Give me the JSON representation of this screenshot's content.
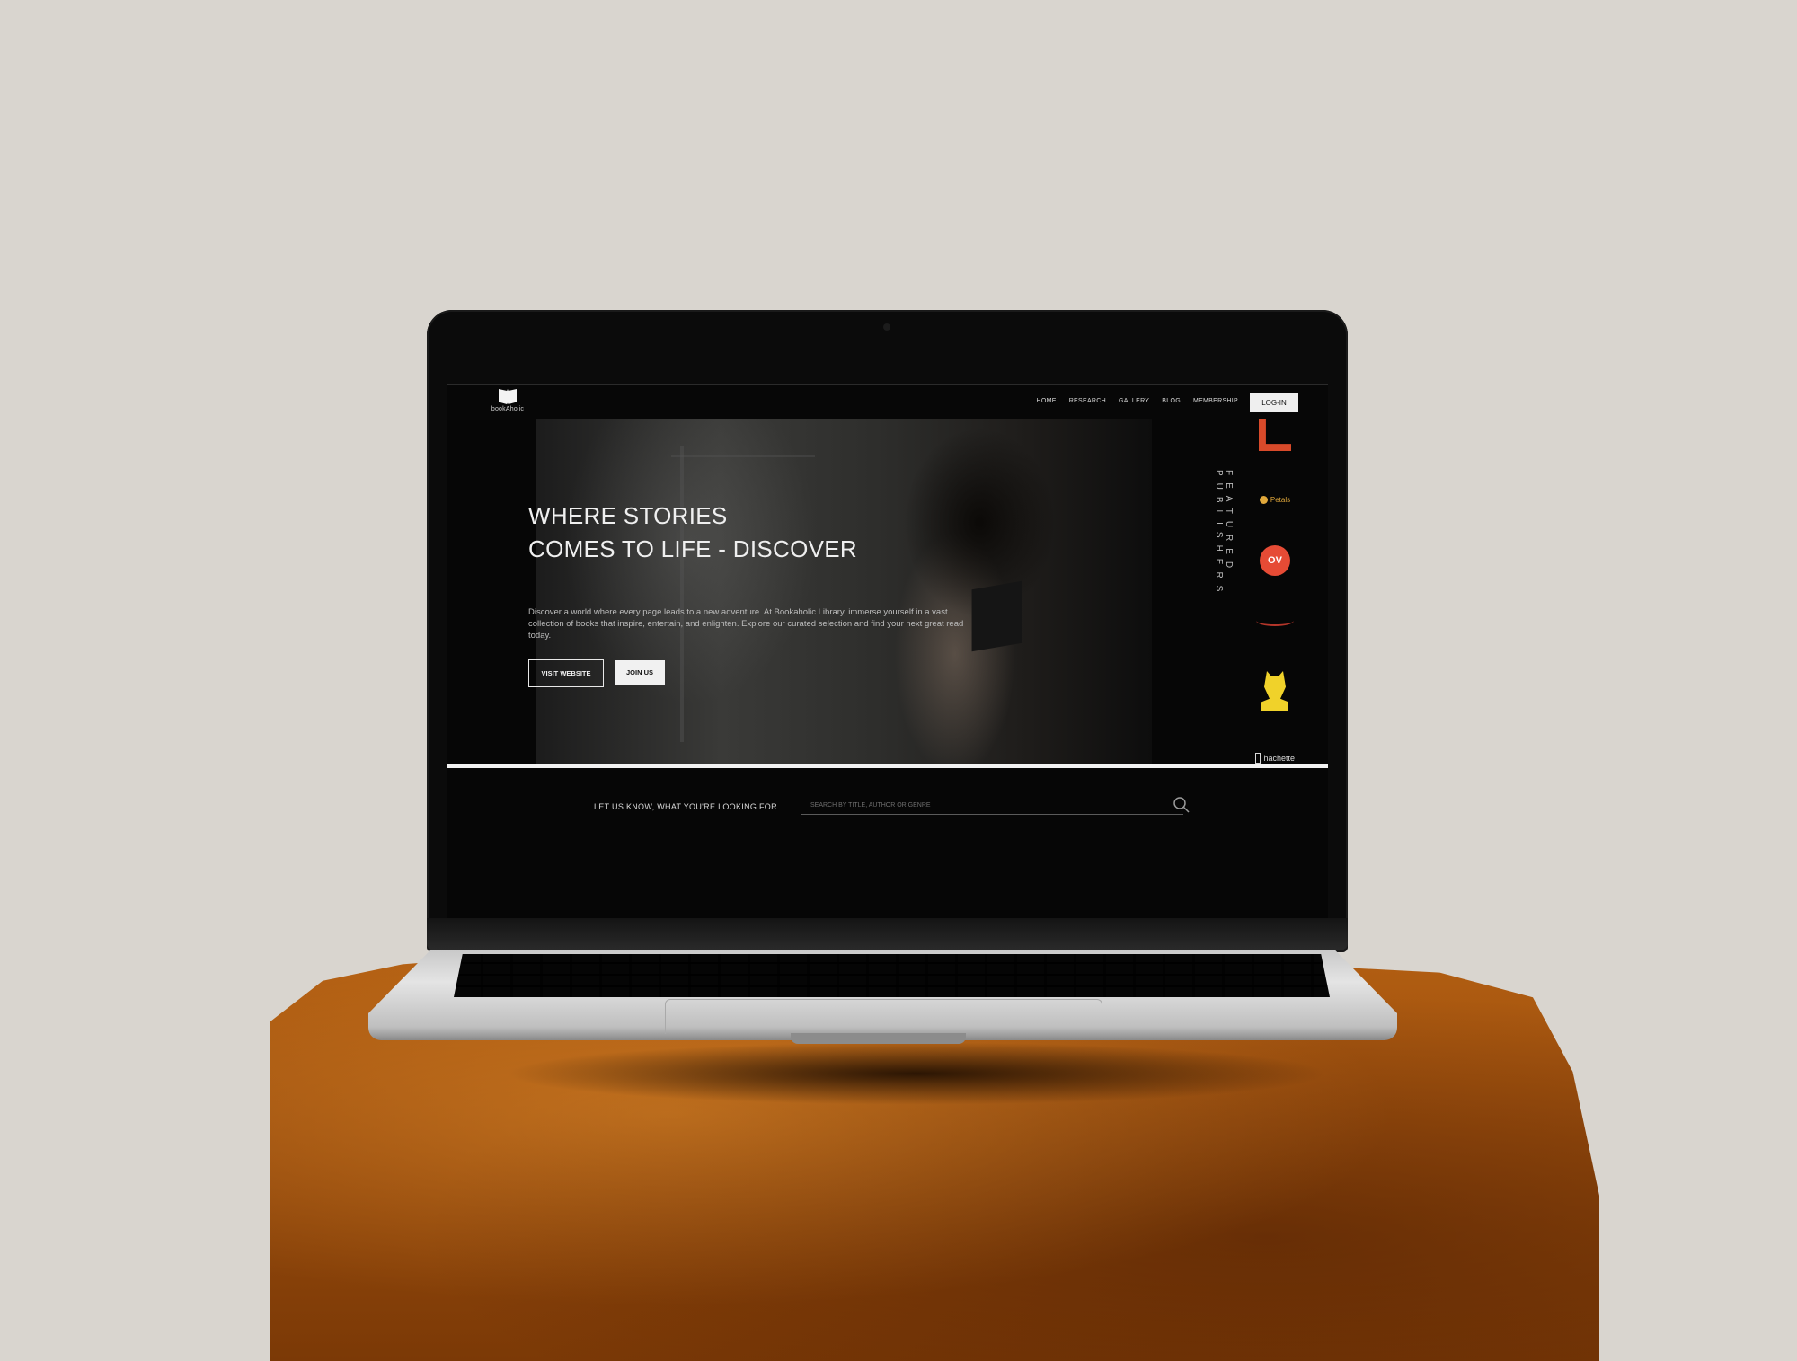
{
  "nav": {
    "logo_text": "bookAholic",
    "items": [
      "HOME",
      "RESEARCH",
      "GALLERY",
      "BLOG",
      "MEMBERSHIP"
    ],
    "login_label": "LOG-IN"
  },
  "hero": {
    "title_line1": "WHERE STORIES",
    "title_line2": "COMES TO LIFE - DISCOVER",
    "description": "Discover a world where every page leads to a new adventure. At Bookaholic Library, immerse yourself in a vast collection of books that inspire, entertain, and enlighten. Explore our curated selection and find your next great read today.",
    "visit_label": "VISIT WEBSITE",
    "join_label": "JOIN US"
  },
  "featured": {
    "label": "FEATURED PUBLISHERS",
    "publishers": [
      {
        "name_shown": "",
        "icon": "red-building-logo",
        "color": "#d84a2a"
      },
      {
        "name_shown": "Petals",
        "icon": "petals-logo",
        "color": "#e1a83b"
      },
      {
        "name_shown": "OV",
        "icon": "red-circle-logo",
        "color": "#e64b35"
      },
      {
        "name_shown": "",
        "icon": "red-swash-logo",
        "color": "#b5362a"
      },
      {
        "name_shown": "",
        "icon": "yellow-owl-logo",
        "color": "#f0d22a"
      },
      {
        "name_shown": "hachette",
        "icon": "hachette-logo",
        "color": "#d8d8d8"
      }
    ]
  },
  "search": {
    "label": "LET US KNOW, WHAT YOU'RE LOOKING FOR ...",
    "placeholder": "SEARCH BY TITLE, AUTHOR OR GENRE"
  }
}
